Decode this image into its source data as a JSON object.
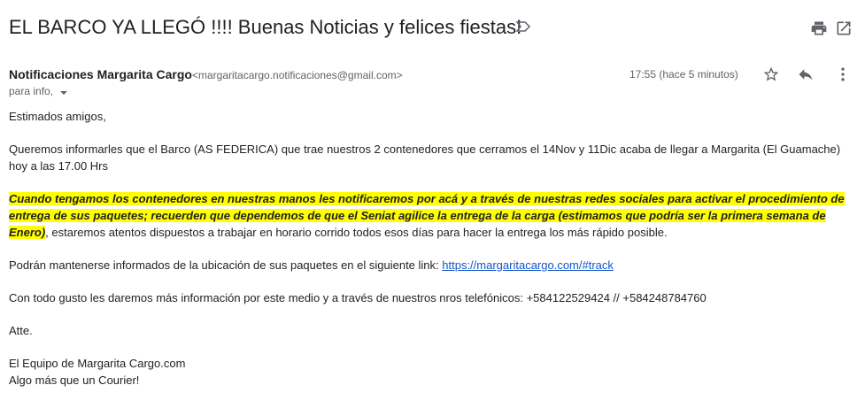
{
  "email": {
    "subject": "EL BARCO YA LLEGÓ !!!! Buenas Noticias y felices fiestas!",
    "sender_name": "Notificaciones Margarita Cargo",
    "sender_email": "<margaritacargo.notificaciones@gmail.com>",
    "time": "17:55 (hace 5 minutos)",
    "recipient": "para info,",
    "body": {
      "greeting": "Estimados amigos,",
      "para1": "Queremos informarles que el Barco (AS FEDERICA) que trae nuestros 2 contenedores que cerramos el 14Nov y 11Dic  acaba de llegar a Margarita (El Guamache) hoy a las 17.00 Hrs",
      "para2_highlight": "Cuando tengamos los contenedores en nuestras manos les notificaremos por acá y a través de nuestras redes sociales para activar el procedimiento de entrega de sus paquetes; recuerden que dependemos de que el Seniat agilice la entrega de la carga (estimamos que podría ser la primera semana de Enero)",
      "para2_rest": ", estaremos atentos dispuestos a trabajar en horario corrido todos esos días para hacer la entrega los más rápido posible.",
      "para3_prefix": "Podrán mantenerse informados de la ubicación de sus paquetes en el siguiente link: ",
      "para3_link": "https://margaritacargo.com/#track",
      "para4": "Con todo gusto les daremos más información por este medio y a través de nuestros nros telefónicos: +584122529424  // +584248784760",
      "closing": "Atte.",
      "signature_line1": "El Equipo de Margarita Cargo.com",
      "signature_line2": "Algo más que un Courier!"
    }
  },
  "icons": {
    "label": "label-important-icon",
    "print": "print-icon",
    "popout": "open-in-new-window-icon",
    "star": "star-icon",
    "reply": "reply-icon",
    "more": "more-vertical-icon",
    "recipient_details": "chevron-down-icon"
  },
  "colors": {
    "highlight": "#ffff00",
    "link": "#1155cc",
    "icon": "#5f6368"
  }
}
